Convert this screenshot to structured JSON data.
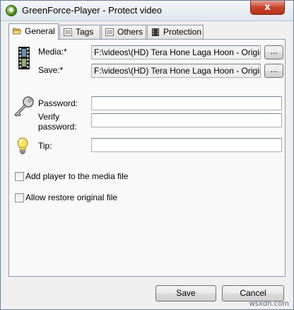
{
  "window": {
    "title": "GreenForce-Player - Protect video",
    "close_glyph": "x"
  },
  "tabs": [
    {
      "label": "General",
      "icon": "folder-open-icon",
      "active": true
    },
    {
      "label": "Tags",
      "icon": "list-icon",
      "active": false
    },
    {
      "label": "Others",
      "icon": "list-icon",
      "active": false
    },
    {
      "label": "Protection",
      "icon": "film-icon",
      "active": false
    }
  ],
  "form": {
    "media_label": "Media:*",
    "media_value": "F:\\videos\\(HD) Tera Hone Laga Hoon - Original F",
    "save_label": "Save:*",
    "save_value": "F:\\videos\\(HD) Tera Hone Laga Hoon - Original F",
    "browse_label": "...",
    "password_label": "Password:",
    "password_value": "",
    "verify_label_1": "Verify",
    "verify_label_2": "password:",
    "verify_value": "",
    "tip_label": "Tip:",
    "tip_value": ""
  },
  "options": {
    "add_player_label": "Add player to the media file",
    "add_player_checked": false,
    "allow_restore_label": "Allow restore original file",
    "allow_restore_checked": false
  },
  "buttons": {
    "save": "Save",
    "cancel": "Cancel"
  },
  "watermark": "wsxdn.com"
}
